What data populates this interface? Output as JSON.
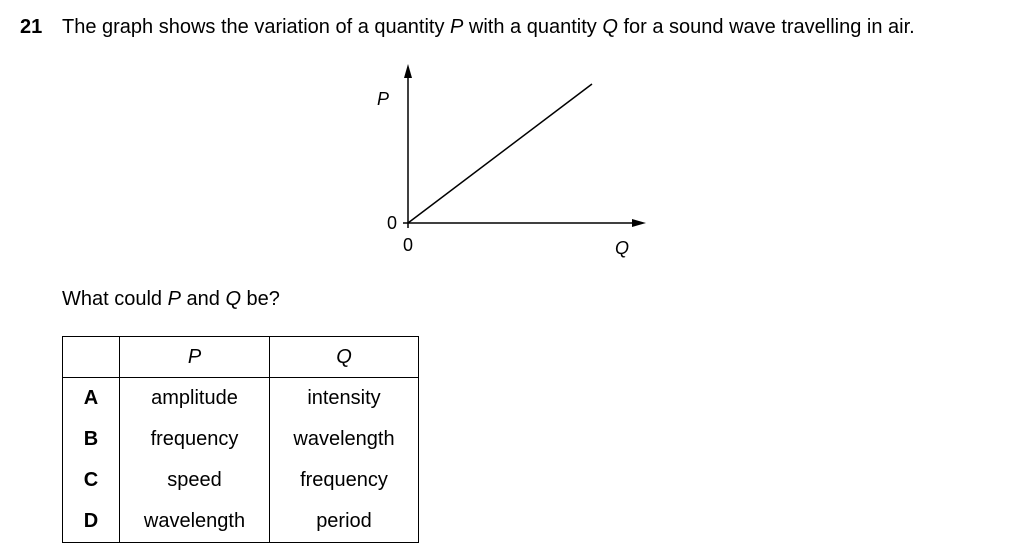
{
  "question": {
    "number": "21",
    "text_before": "The graph shows the variation of a quantity ",
    "var_p": "P",
    "text_middle": " with a quantity ",
    "var_q": "Q",
    "text_after": " for a sound wave travelling in air."
  },
  "graph": {
    "y_axis_label": "P",
    "x_axis_label": "Q",
    "y_origin_label": "0",
    "x_origin_label": "0"
  },
  "prompt": {
    "before": "What could ",
    "var_p": "P",
    "middle": " and ",
    "var_q": "Q",
    "after": " be?"
  },
  "table": {
    "header_p": "P",
    "header_q": "Q",
    "rows": [
      {
        "letter": "A",
        "p": "amplitude",
        "q": "intensity"
      },
      {
        "letter": "B",
        "p": "frequency",
        "q": "wavelength"
      },
      {
        "letter": "C",
        "p": "speed",
        "q": "frequency"
      },
      {
        "letter": "D",
        "p": "wavelength",
        "q": "period"
      }
    ]
  }
}
